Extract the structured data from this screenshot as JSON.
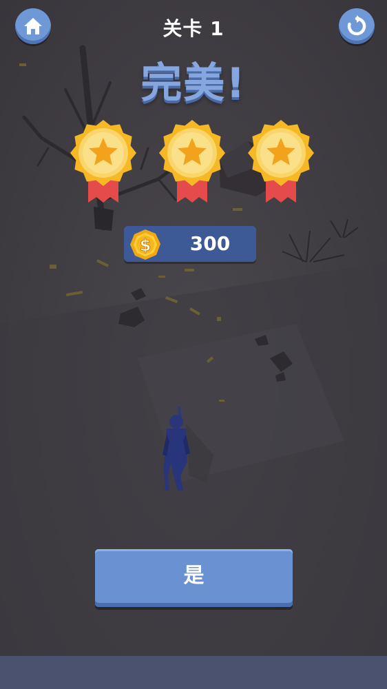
{
  "header": {
    "level_label": "关卡 1",
    "home_button": "home-icon",
    "restart_button": "restart-icon"
  },
  "result": {
    "title": "完美!",
    "stars_earned": 3,
    "stars_total": 3
  },
  "reward": {
    "coin_icon": "dollar-coin-icon",
    "coins": "300"
  },
  "actions": {
    "confirm_label": "是"
  },
  "colors": {
    "accent_blue": "#6a92d2",
    "title_blue": "#86a6df",
    "medal_gold": "#f6b824",
    "ribbon_red": "#e64b4b",
    "panel_blue": "#3d5a97"
  }
}
